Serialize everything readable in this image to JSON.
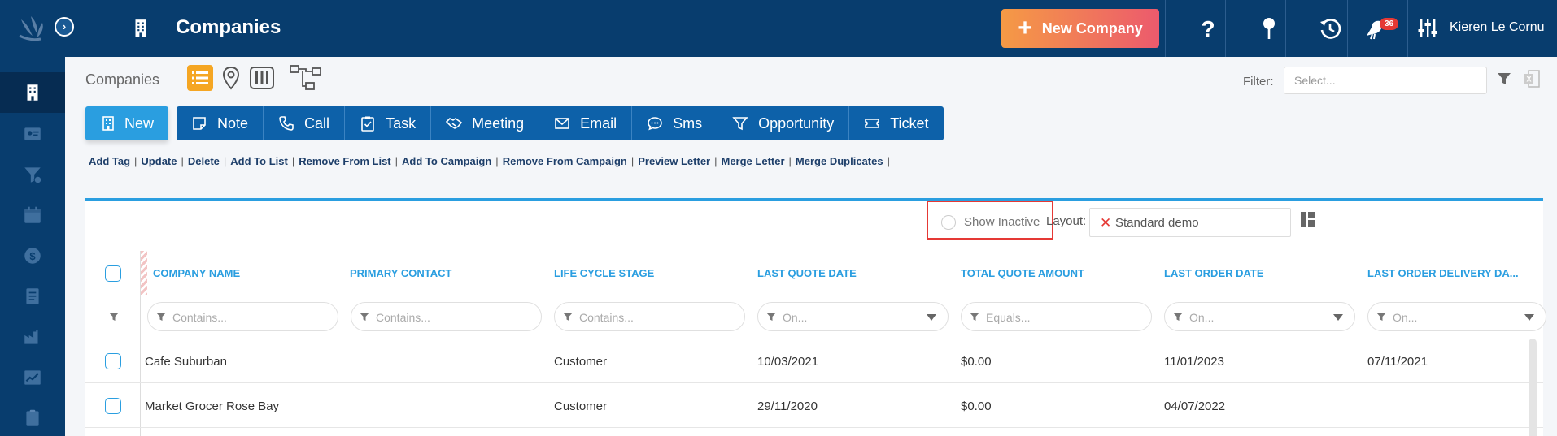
{
  "topbar": {
    "title": "Companies",
    "new_company_label": "New Company",
    "notifications_count": "36",
    "user_name": "Kieren Le Cornu"
  },
  "sidebar": {
    "items": [
      "companies",
      "contacts",
      "leads",
      "calendar",
      "finance",
      "tasks",
      "reports",
      "analytics",
      "documents"
    ]
  },
  "content": {
    "breadcrumb": "Companies",
    "filter": {
      "label": "Filter:",
      "placeholder": "Select..."
    },
    "new_button": "New",
    "action_buttons": [
      "Note",
      "Call",
      "Task",
      "Meeting",
      "Email",
      "Sms",
      "Opportunity",
      "Ticket"
    ],
    "links": [
      "Add Tag",
      "Update",
      "Delete",
      "Add To List",
      "Remove From List",
      "Add To Campaign",
      "Remove From Campaign",
      "Preview Letter",
      "Merge Letter",
      "Merge Duplicates"
    ],
    "show_inactive": "Show Inactive",
    "layout_label": "Layout:",
    "layout_value": "Standard demo"
  },
  "grid": {
    "columns": [
      "COMPANY NAME",
      "PRIMARY CONTACT",
      "LIFE CYCLE STAGE",
      "LAST QUOTE DATE",
      "TOTAL QUOTE AMOUNT",
      "LAST ORDER DATE",
      "LAST ORDER DELIVERY DA..."
    ],
    "filters": [
      "Contains...",
      "Contains...",
      "Contains...",
      "On...",
      "Equals...",
      "On...",
      "On..."
    ],
    "rows": [
      [
        "Cafe Suburban",
        "",
        "Customer",
        "10/03/2021",
        "$0.00",
        "11/01/2023",
        "07/11/2021"
      ],
      [
        "Market Grocer Rose Bay",
        "",
        "Customer",
        "29/11/2020",
        "$0.00",
        "04/07/2022",
        ""
      ]
    ]
  },
  "colors": {
    "nav_bg": "#083d6e",
    "accent_blue": "#2a9ee0",
    "button_blue": "#0d61a9",
    "highlight_red": "#e53935"
  }
}
